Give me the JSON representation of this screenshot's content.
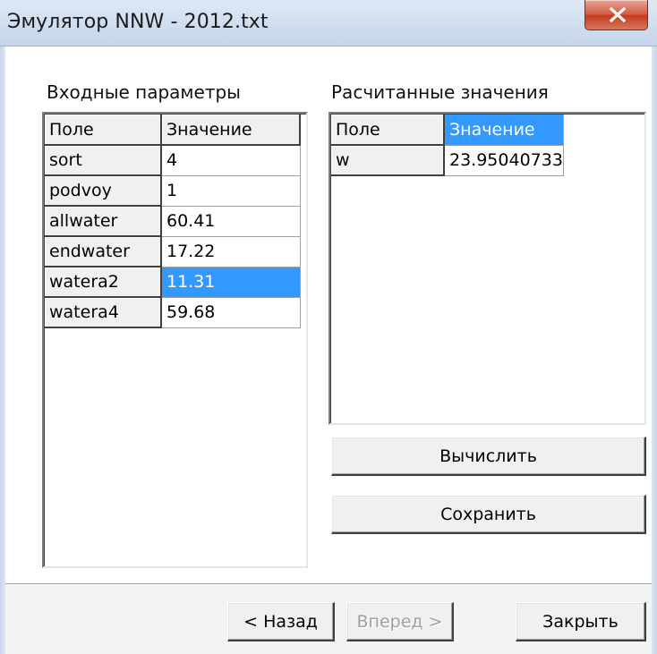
{
  "window": {
    "title": "Эмулятор NNW - 2012.txt",
    "close_icon": "close-x-icon"
  },
  "input_params": {
    "label": "Входные параметры",
    "headers": [
      "Поле",
      "Значение"
    ],
    "rows": [
      {
        "field": "sort",
        "value": "4"
      },
      {
        "field": "podvoy",
        "value": "1"
      },
      {
        "field": "allwater",
        "value": "60.41"
      },
      {
        "field": "endwater",
        "value": "17.22"
      },
      {
        "field": "watera2",
        "value": "11.31",
        "selected": true
      },
      {
        "field": "watera4",
        "value": "59.68"
      }
    ]
  },
  "computed_values": {
    "label": "Расчитанные значения",
    "headers": [
      "Поле",
      "Значение"
    ],
    "header_selected": "Значение",
    "rows": [
      {
        "field": "w",
        "value": "23.95040733"
      }
    ]
  },
  "actions": {
    "compute_label": "Вычислить",
    "save_label": "Сохранить"
  },
  "footer": {
    "back_label": "< Назад",
    "next_label": "Вперед >",
    "next_enabled": false,
    "close_label": "Закрыть"
  },
  "colors": {
    "selection": "#3399ff",
    "close_button": "#c8452a"
  }
}
